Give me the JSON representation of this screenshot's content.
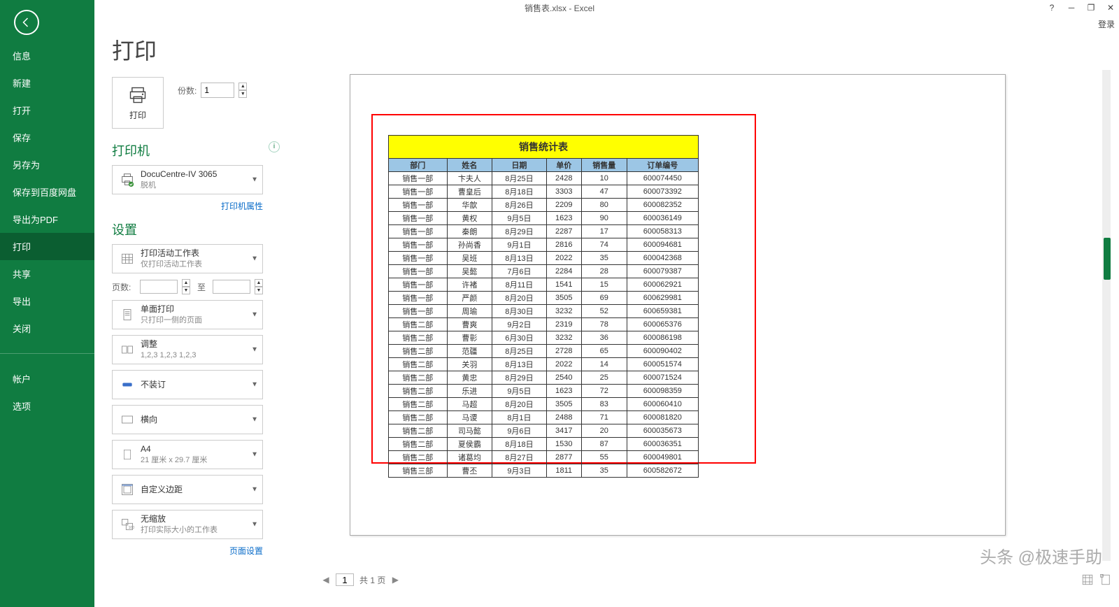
{
  "window": {
    "title": "销售表.xlsx - Excel",
    "signin": "登录"
  },
  "sidebar": {
    "items": [
      "信息",
      "新建",
      "打开",
      "保存",
      "另存为",
      "保存到百度网盘",
      "导出为PDF",
      "打印",
      "共享",
      "导出",
      "关闭"
    ],
    "bottom": [
      "帐户",
      "选项"
    ],
    "active_index": 7
  },
  "print": {
    "heading": "打印",
    "button_label": "打印",
    "copies_label": "份数:",
    "copies_value": "1"
  },
  "printer": {
    "section": "打印机",
    "name": "DocuCentre-IV 3065",
    "status": "脱机",
    "props_link": "打印机属性"
  },
  "settings": {
    "section": "设置",
    "active_sheet": {
      "main": "打印活动工作表",
      "sub": "仅打印活动工作表"
    },
    "pages_label": "页数:",
    "to_label": "至",
    "sides": {
      "main": "单面打印",
      "sub": "只打印一侧的页面"
    },
    "collate": {
      "main": "调整",
      "sub": "1,2,3    1,2,3    1,2,3"
    },
    "staple": {
      "main": "不装订"
    },
    "orient": {
      "main": "横向"
    },
    "paper": {
      "main": "A4",
      "sub": "21 厘米 x 29.7 厘米"
    },
    "margins": {
      "main": "自定义边距"
    },
    "scale": {
      "main": "无缩放",
      "sub": "打印实际大小的工作表"
    },
    "page_setup_link": "页面设置"
  },
  "page_nav": {
    "current": "1",
    "total_text": "共 1 页"
  },
  "sheet": {
    "title": "销售统计表",
    "headers": [
      "部门",
      "姓名",
      "日期",
      "单价",
      "销售量",
      "订单编号"
    ],
    "rows": [
      [
        "销售一部",
        "卞夫人",
        "8月25日",
        "2428",
        "10",
        "600074450"
      ],
      [
        "销售一部",
        "曹皇后",
        "8月18日",
        "3303",
        "47",
        "600073392"
      ],
      [
        "销售一部",
        "华歆",
        "8月26日",
        "2209",
        "80",
        "600082352"
      ],
      [
        "销售一部",
        "黄权",
        "9月5日",
        "1623",
        "90",
        "600036149"
      ],
      [
        "销售一部",
        "秦朗",
        "8月29日",
        "2287",
        "17",
        "600058313"
      ],
      [
        "销售一部",
        "孙尚香",
        "9月1日",
        "2816",
        "74",
        "600094681"
      ],
      [
        "销售一部",
        "吴班",
        "8月13日",
        "2022",
        "35",
        "600042368"
      ],
      [
        "销售一部",
        "吴懿",
        "7月6日",
        "2284",
        "28",
        "600079387"
      ],
      [
        "销售一部",
        "许褚",
        "8月11日",
        "1541",
        "15",
        "600062921"
      ],
      [
        "销售一部",
        "严颜",
        "8月20日",
        "3505",
        "69",
        "600629981"
      ],
      [
        "销售一部",
        "周瑜",
        "8月30日",
        "3232",
        "52",
        "600659381"
      ],
      [
        "销售二部",
        "曹爽",
        "9月2日",
        "2319",
        "78",
        "600065376"
      ],
      [
        "销售二部",
        "曹彰",
        "6月30日",
        "3232",
        "36",
        "600086198"
      ],
      [
        "销售二部",
        "范疆",
        "8月25日",
        "2728",
        "65",
        "600090402"
      ],
      [
        "销售二部",
        "关羽",
        "8月13日",
        "2022",
        "14",
        "600051574"
      ],
      [
        "销售二部",
        "黄忠",
        "8月29日",
        "2540",
        "25",
        "600071524"
      ],
      [
        "销售二部",
        "乐进",
        "9月5日",
        "1623",
        "72",
        "600098359"
      ],
      [
        "销售二部",
        "马超",
        "8月20日",
        "3505",
        "83",
        "600060410"
      ],
      [
        "销售二部",
        "马谡",
        "8月1日",
        "2488",
        "71",
        "600081820"
      ],
      [
        "销售二部",
        "司马懿",
        "9月6日",
        "3417",
        "20",
        "600035673"
      ],
      [
        "销售二部",
        "夏侯霸",
        "8月18日",
        "1530",
        "87",
        "600036351"
      ],
      [
        "销售二部",
        "诸葛均",
        "8月27日",
        "2877",
        "55",
        "600049801"
      ],
      [
        "销售三部",
        "曹丕",
        "9月3日",
        "1811",
        "35",
        "600582672"
      ]
    ]
  },
  "watermark": "头条 @极速手助"
}
